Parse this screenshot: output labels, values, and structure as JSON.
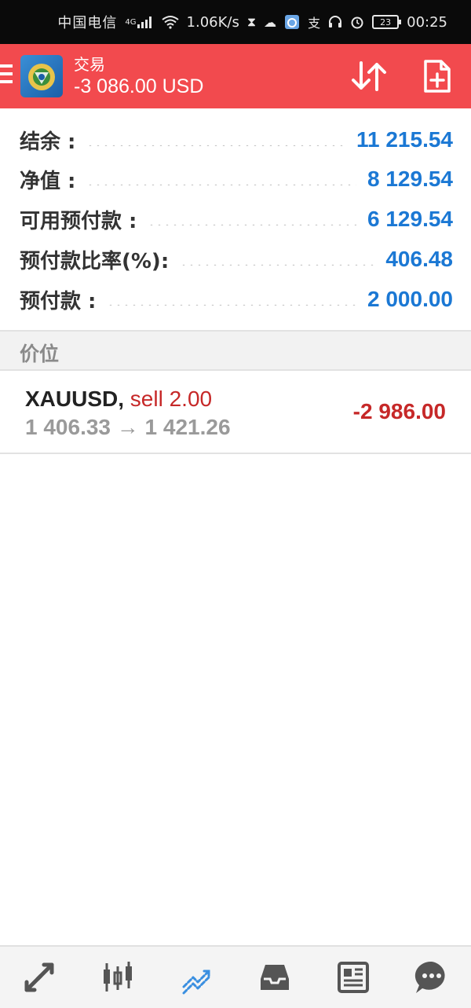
{
  "status_bar": {
    "carrier": "中国电信",
    "network": "4G",
    "speed": "1.06K/s",
    "battery": "23",
    "time": "00:25"
  },
  "app_bar": {
    "title": "交易",
    "balance": "-3 086.00 USD"
  },
  "account": {
    "rows": [
      {
        "label": "结余 :",
        "value": "11 215.54"
      },
      {
        "label": "净值 :",
        "value": "8 129.54"
      },
      {
        "label": "可用预付款 :",
        "value": "6 129.54"
      },
      {
        "label": "预付款比率(%):",
        "value": "406.48"
      },
      {
        "label": "预付款 :",
        "value": "2 000.00"
      }
    ]
  },
  "positions_section": {
    "title": "价位"
  },
  "positions": [
    {
      "symbol": "XAUUSD,",
      "side": "sell 2.00",
      "prices": "1 406.33 → 1 421.26",
      "profit": "-2 986.00"
    }
  ],
  "bottom_nav": {
    "items": [
      {
        "icon": "quotes-icon"
      },
      {
        "icon": "chart-icon"
      },
      {
        "icon": "trade-icon"
      },
      {
        "icon": "history-icon"
      },
      {
        "icon": "news-icon"
      },
      {
        "icon": "messages-icon"
      }
    ]
  },
  "colors": {
    "accent": "#f24a4e",
    "value_blue": "#1b78d4",
    "loss_red": "#c62828",
    "active_nav": "#3a8fe0"
  }
}
